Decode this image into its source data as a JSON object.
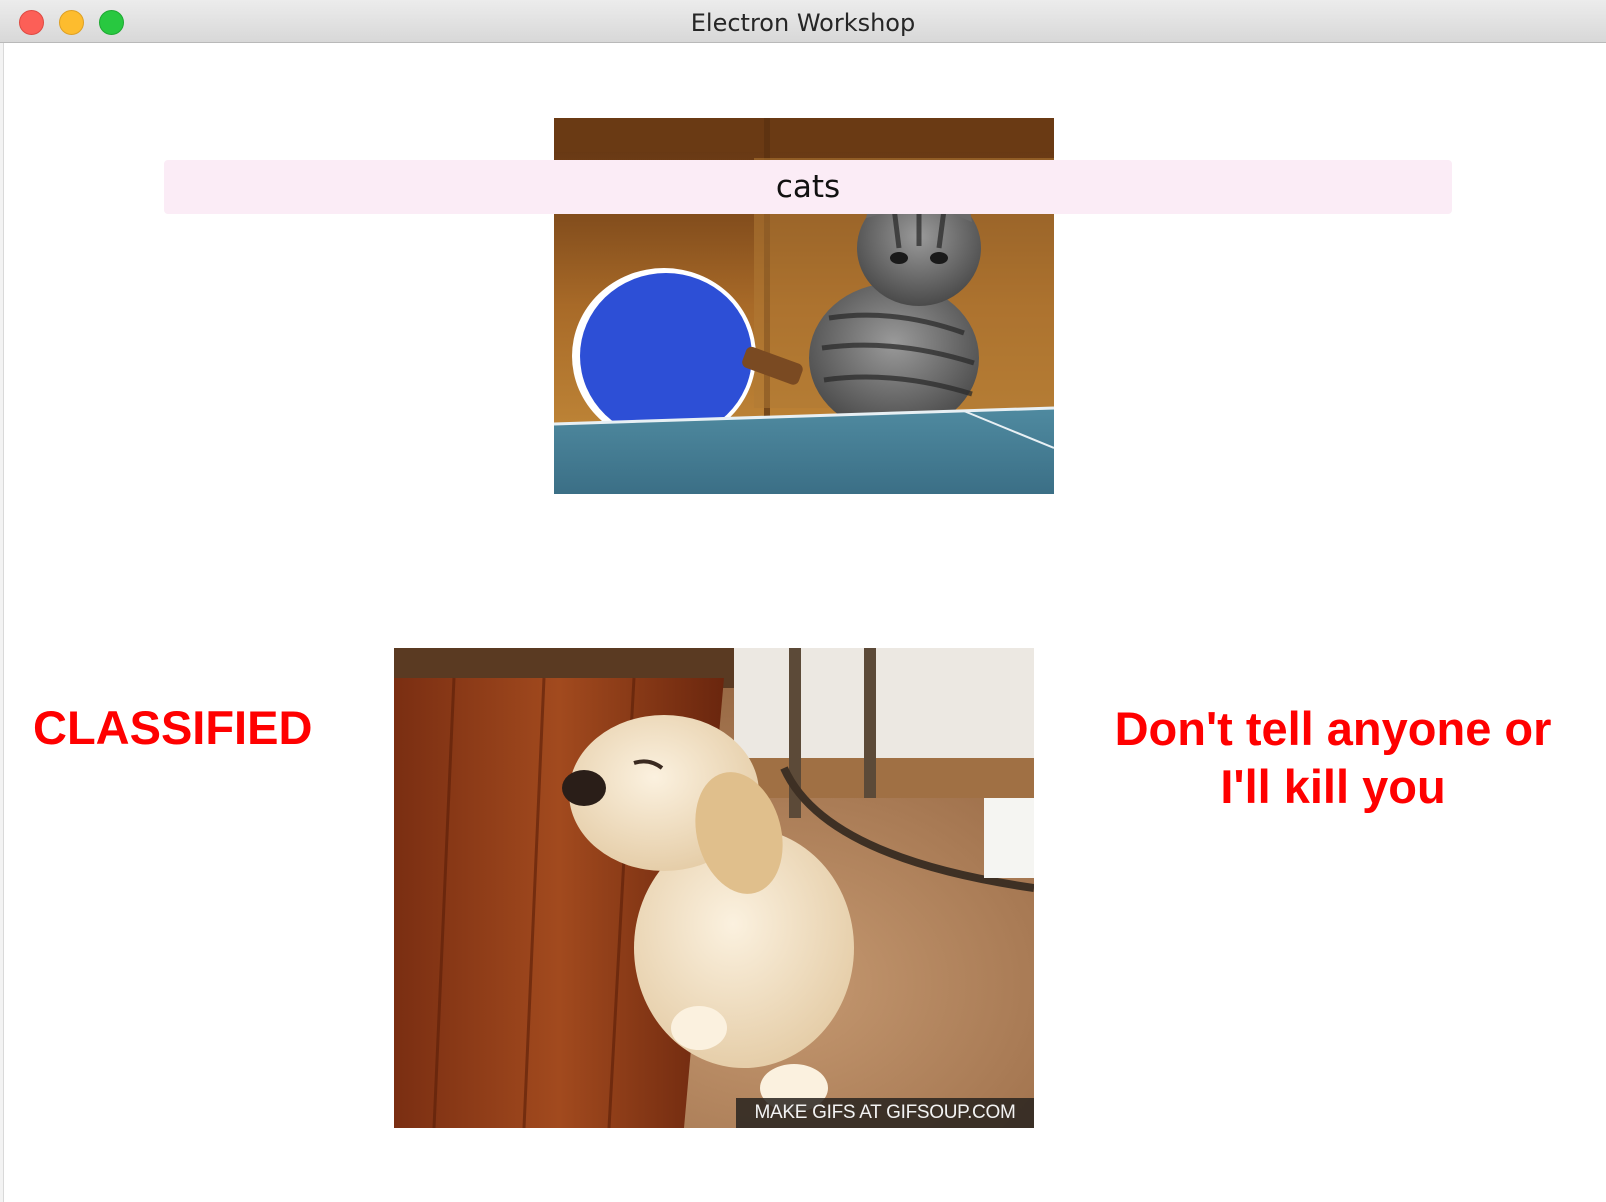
{
  "window": {
    "title": "Electron Workshop"
  },
  "search": {
    "value": "cats"
  },
  "images": {
    "cat": {
      "subject": "cat playing ping pong",
      "paddle_color": "#2d4fd6"
    },
    "dog": {
      "subject": "sleepy puppy",
      "watermark": "MAKE GIFS AT GIFSOUP.COM"
    }
  },
  "labels": {
    "classified": "CLASSIFIED",
    "warning": "Don't tell anyone or I'll kill you"
  },
  "colors": {
    "alert_text": "#ff0000",
    "search_bg": "#fbecf6"
  }
}
